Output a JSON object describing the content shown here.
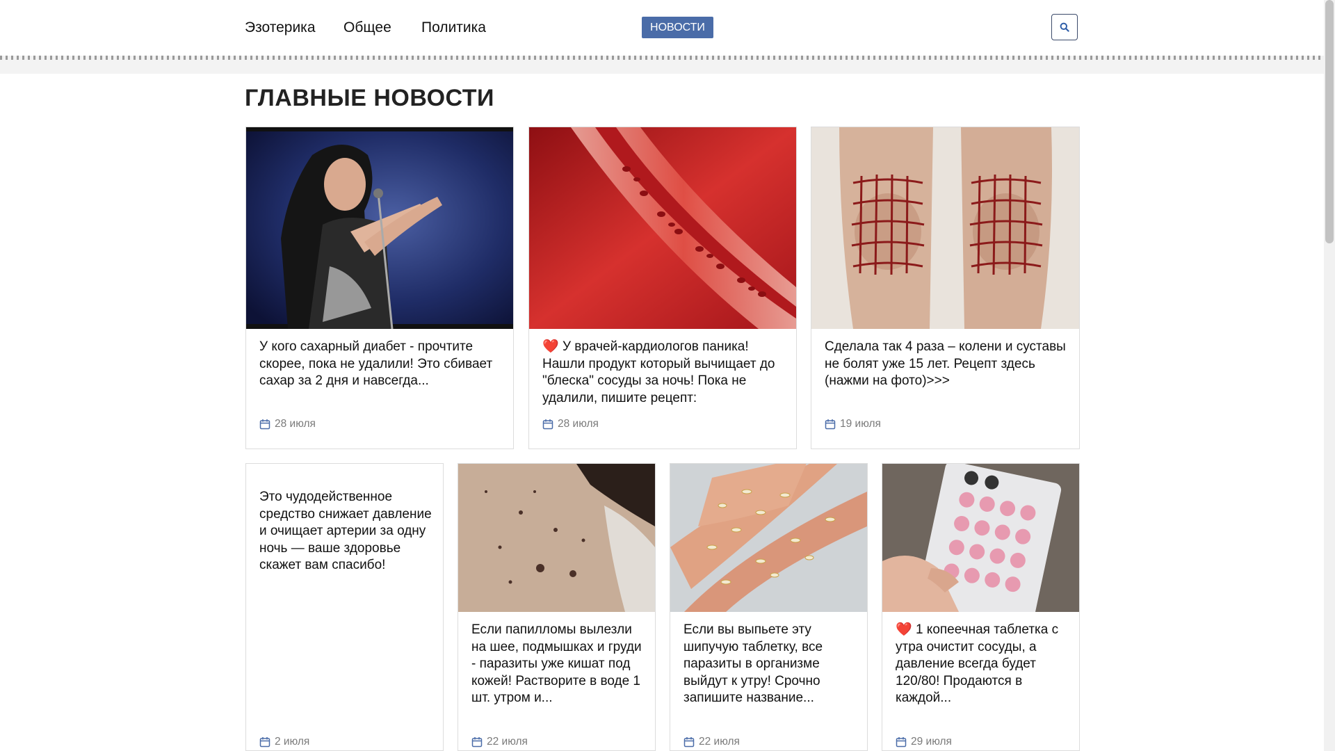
{
  "nav": {
    "items": [
      "Эзотерика",
      "Общее",
      "Политика"
    ],
    "active": "НОВОСТИ",
    "search_icon": "search-icon"
  },
  "section_title": "ГЛАВНЫЕ НОВОСТИ",
  "row1": [
    {
      "image": "singer-on-stage",
      "text": "У кого сахарный диабет - прочтите скорее, пока не удалили! Это сбивает сахар за 2 дня и навсегда...",
      "date": "28 июля"
    },
    {
      "heart": "❤️",
      "image": "blood-vessel",
      "text": "У врачей-кардиологов паника! Нашли продукт который вычищает до \"блеска\" сосуды за ночь! Пока не удалили, пишите рецепт:",
      "date": "28 июля"
    },
    {
      "image": "knees-grid",
      "text": "Сделала так 4 раза – колени и суставы не болят уже 15 лет. Рецепт здесь (нажми на фото)>>>",
      "date": "19 июля"
    }
  ],
  "row2": [
    {
      "text": "Это чудодейственное средство снижает давление и очищает артерии за одну ночь — ваше здоровье скажет вам спасибо!",
      "date": "2 июля"
    },
    {
      "image": "skin-papillomas",
      "text": "Если папилломы вылезли на шее, подмышках и груди - паразиты уже кишат под кожей! Растворите в воде 1 шт. утром и...",
      "date": "22 июля"
    },
    {
      "image": "fingers-parasites",
      "text": "Если вы выпьете эту шипучую таблетку, все паразиты в организме выйдут к утру! Срочно запишите название...",
      "date": "22 июля"
    },
    {
      "heart": "❤️",
      "image": "pink-pills-blister",
      "text": "1 копеечная таблетка с утра очистит сосуды, а давление всегда будет 120/80! Продаются в каждой...",
      "date": "29 июля"
    }
  ],
  "colors": {
    "accent": "#4a6ca8",
    "heart": "#d91e2a",
    "date": "#7a7a7a"
  },
  "date_icon": "calendar-icon"
}
